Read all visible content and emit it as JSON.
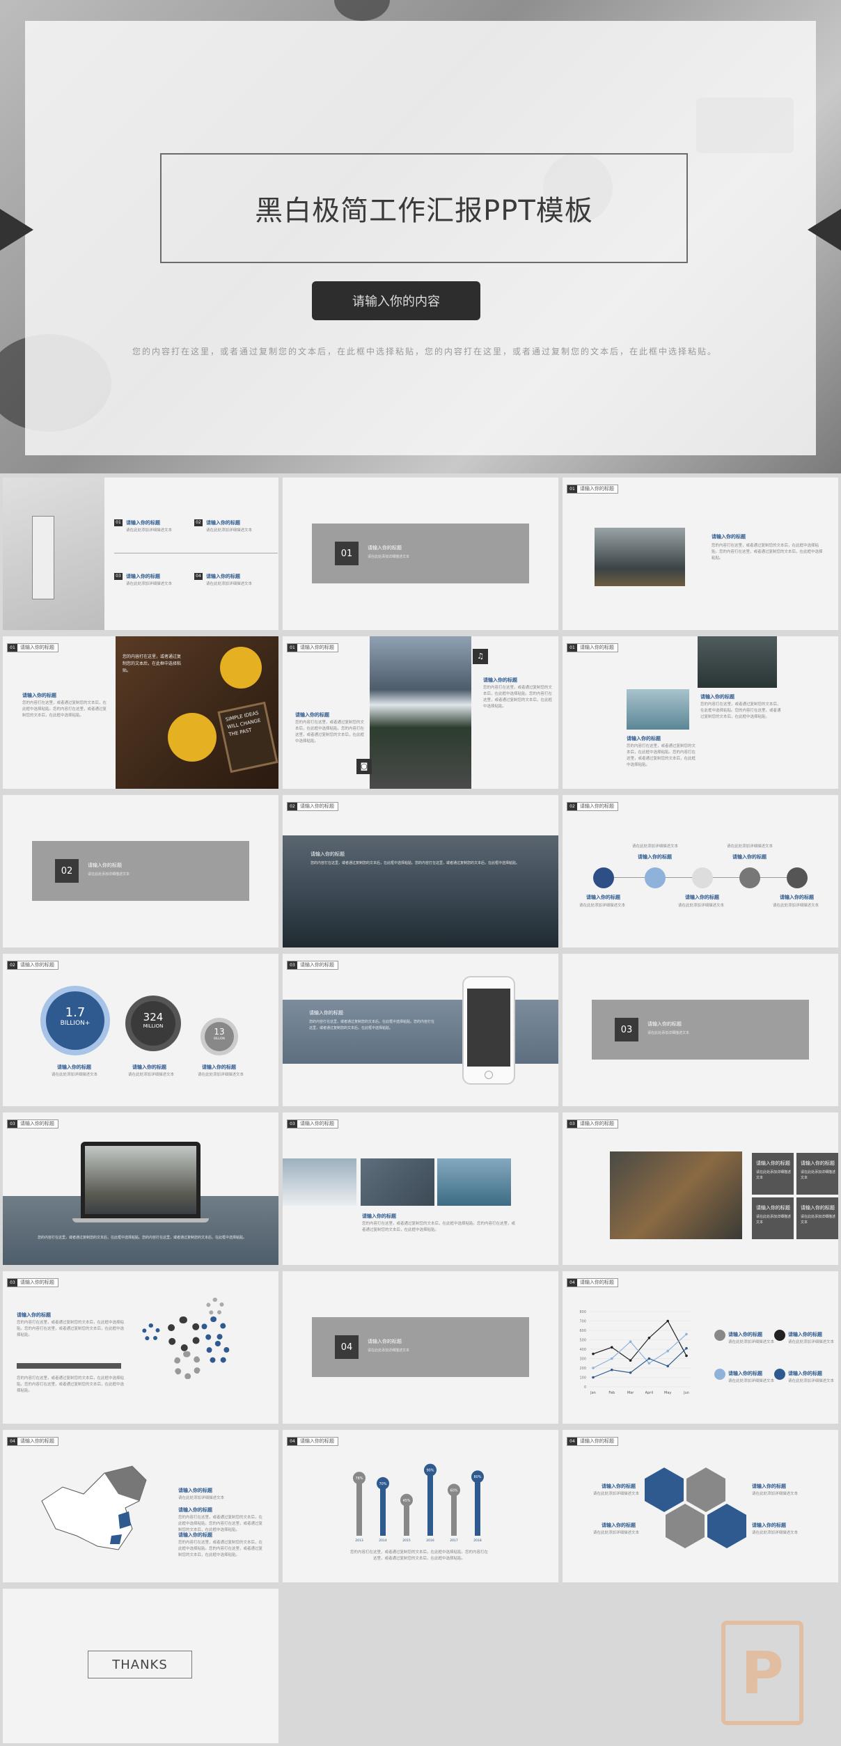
{
  "hero": {
    "title": "黑白极简工作汇报PPT模板",
    "button": "请输入你的内容",
    "desc": "您的内容打在这里，或者通过复制您的文本后，在此框中选择粘贴，您的内容打在这里，或者通过复制您的文本后，在此框中选择粘贴。"
  },
  "common": {
    "tag_title": "请输入你的标题",
    "heading": "请输入你的标题",
    "sub": "请输入你的标题",
    "desc_short": "请在此处添加详细描述文本",
    "desc_long": "您的内容打在这里，或者通过复制您的文本后，在此框中选择粘贴。您的内容打在这里，或者通过复制您的文本后，在此框中选择粘贴。"
  },
  "section_nums": {
    "n01": "01",
    "n02": "02",
    "n03": "03",
    "n04": "04"
  },
  "toc": {
    "i1": "01",
    "i2": "02",
    "i3": "03",
    "i4": "04"
  },
  "slide_tags": {
    "t01": "01",
    "t02": "02",
    "t03": "03",
    "t04": "04"
  },
  "stats": {
    "s1_value": "1.7",
    "s1_unit": "BILLION+",
    "s2_value": "324",
    "s2_unit": "MILLION",
    "s3_value": "13",
    "s3_unit": "BILLION"
  },
  "coffee_text": "您的内容打在这里，或者通过复制您的文本后，在此框中选择粘贴。",
  "sign_text": "SIMPLE IDEAS WILL CHANGE THE PAST",
  "chart_data": {
    "type": "line",
    "categories": [
      "Jan",
      "Feb",
      "Mar",
      "April",
      "May",
      "Jun"
    ],
    "ylim": [
      0,
      800
    ],
    "yticks": [
      "800",
      "700",
      "600",
      "500",
      "400",
      "300",
      "200",
      "100",
      "0"
    ],
    "series": [
      {
        "values": [
          350,
          420,
          280,
          520,
          700,
          330
        ]
      },
      {
        "values": [
          200,
          300,
          480,
          250,
          380,
          560
        ]
      },
      {
        "values": [
          100,
          180,
          150,
          300,
          220,
          410
        ]
      }
    ]
  },
  "bars_chart": {
    "values": [
      "78%",
      "70%",
      "45%",
      "90%",
      "60%",
      "80%"
    ],
    "labels": [
      "2013",
      "2014",
      "2015",
      "2016",
      "2017",
      "2018"
    ]
  },
  "thanks": "THANKS",
  "watermark": "P"
}
